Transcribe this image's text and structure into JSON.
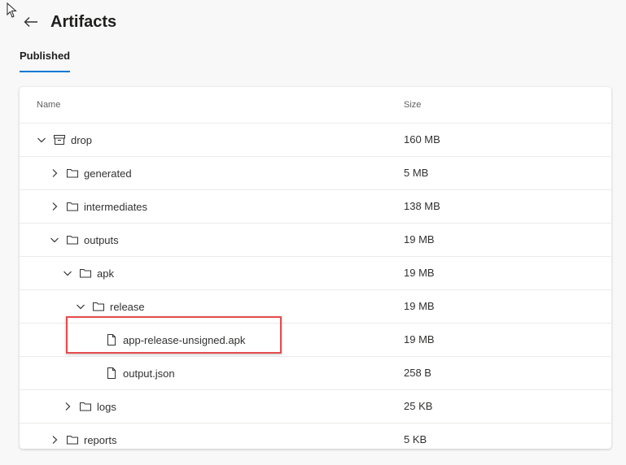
{
  "header": {
    "title": "Artifacts"
  },
  "tabs": [
    {
      "label": "Published",
      "active": true
    }
  ],
  "table": {
    "columns": {
      "name": "Name",
      "size": "Size"
    },
    "rows": [
      {
        "name": "drop",
        "size": "160 MB",
        "depth": 0,
        "type": "artifact",
        "chevron": "down"
      },
      {
        "name": "generated",
        "size": "5 MB",
        "depth": 1,
        "type": "folder",
        "chevron": "right"
      },
      {
        "name": "intermediates",
        "size": "138 MB",
        "depth": 1,
        "type": "folder",
        "chevron": "right"
      },
      {
        "name": "outputs",
        "size": "19 MB",
        "depth": 1,
        "type": "folder",
        "chevron": "down"
      },
      {
        "name": "apk",
        "size": "19 MB",
        "depth": 2,
        "type": "folder",
        "chevron": "down"
      },
      {
        "name": "release",
        "size": "19 MB",
        "depth": 3,
        "type": "folder",
        "chevron": "down"
      },
      {
        "name": "app-release-unsigned.apk",
        "size": "19 MB",
        "depth": 4,
        "type": "file",
        "chevron": "none",
        "highlighted": true
      },
      {
        "name": "output.json",
        "size": "258 B",
        "depth": 4,
        "type": "file",
        "chevron": "none"
      },
      {
        "name": "logs",
        "size": "25 KB",
        "depth": 2,
        "type": "folder",
        "chevron": "right"
      },
      {
        "name": "reports",
        "size": "5 KB",
        "depth": 1,
        "type": "folder",
        "chevron": "right"
      }
    ]
  },
  "colors": {
    "accent": "#0078d4",
    "highlight_border": "#e54b4b"
  }
}
